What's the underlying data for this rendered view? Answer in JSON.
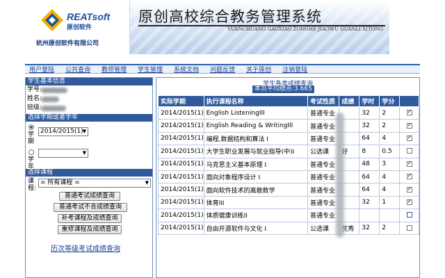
{
  "header": {
    "logo_brand": "REATsoft",
    "logo_sub": "原创软件",
    "company": "杭州原创软件有限公司",
    "banner_title": "原创高校综合教务管理系统",
    "banner_pinyin": "YUANCHUANG GAOXIAO ZONGHE JIAOWU GUANLI XITONG"
  },
  "nav": [
    "用户登陆",
    "公共查询",
    "教师管理",
    "学生管理",
    "系统文档",
    "问题反馈",
    "关于原创",
    "注销登陆"
  ],
  "left": {
    "basic_info_title": "学生基本信息",
    "student_id_label": "学号:",
    "name_label": "姓名:",
    "class_label": "班级:",
    "choose_term_title": "选择学期或者学年",
    "term_label": "学期",
    "year_label": "学年",
    "term_value": "2014/2015(1)",
    "year_value": "",
    "choose_course_title": "选择课程",
    "course_label": "课程:",
    "course_value": "= 所有课程 =",
    "buttons": [
      "普通考试成绩查询",
      "普通考试不合成绩查询",
      "补考课程及成绩查询",
      "重修课程及成绩查询"
    ],
    "link": "历次等级考试成绩查询"
  },
  "right": {
    "title": "学生各类成绩查询",
    "gpa": "本页平均绩点:3.665",
    "columns": [
      "实际学期",
      "执行课程名称",
      "考试性质",
      "成绩",
      "学时",
      "学分",
      ""
    ],
    "rows": [
      {
        "term": "2014/2015(1)",
        "course": "English ListeningIII",
        "type": "普通专业",
        "score": "",
        "hours": "32",
        "credit": "2",
        "checked": true
      },
      {
        "term": "2014/2015(1)",
        "course": "English Reading & WritingIII",
        "type": "普通专业",
        "score": "",
        "hours": "32",
        "credit": "2",
        "checked": true
      },
      {
        "term": "2014/2015(1)",
        "course": "编程,数据结构和算法 I",
        "type": "普通专业",
        "score": "",
        "hours": "64",
        "credit": "4",
        "checked": true
      },
      {
        "term": "2014/2015(1)",
        "course": "大学生职业发展与就业指导(中)I",
        "type": "公选课",
        "score": "好",
        "hours": "8",
        "credit": "0.5",
        "checked": false
      },
      {
        "term": "2014/2015(1)",
        "course": "马克思主义基本原理 I",
        "type": "普通专业",
        "score": "",
        "hours": "48",
        "credit": "3",
        "checked": true
      },
      {
        "term": "2014/2015(1)",
        "course": "面向对象程序设计 I",
        "type": "普通专业",
        "score": "",
        "hours": "64",
        "credit": "4",
        "checked": true
      },
      {
        "term": "2014/2015(1)",
        "course": "面向软件技术的离散数学",
        "type": "普通专业",
        "score": "",
        "hours": "64",
        "credit": "4",
        "checked": true
      },
      {
        "term": "2014/2015(1)",
        "course": "体育III",
        "type": "普通专业",
        "score": "",
        "hours": "32",
        "credit": "1",
        "checked": true
      },
      {
        "term": "2014/2015(1)",
        "course": "体质健康训练II",
        "type": "普通专业",
        "score": "",
        "hours": "",
        "credit": "",
        "checked": false
      },
      {
        "term": "2014/2015(1)",
        "course": "自由开源软件与文化 I",
        "type": "公选课",
        "score": "优秀",
        "hours": "32",
        "credit": "2",
        "checked": false
      }
    ]
  }
}
